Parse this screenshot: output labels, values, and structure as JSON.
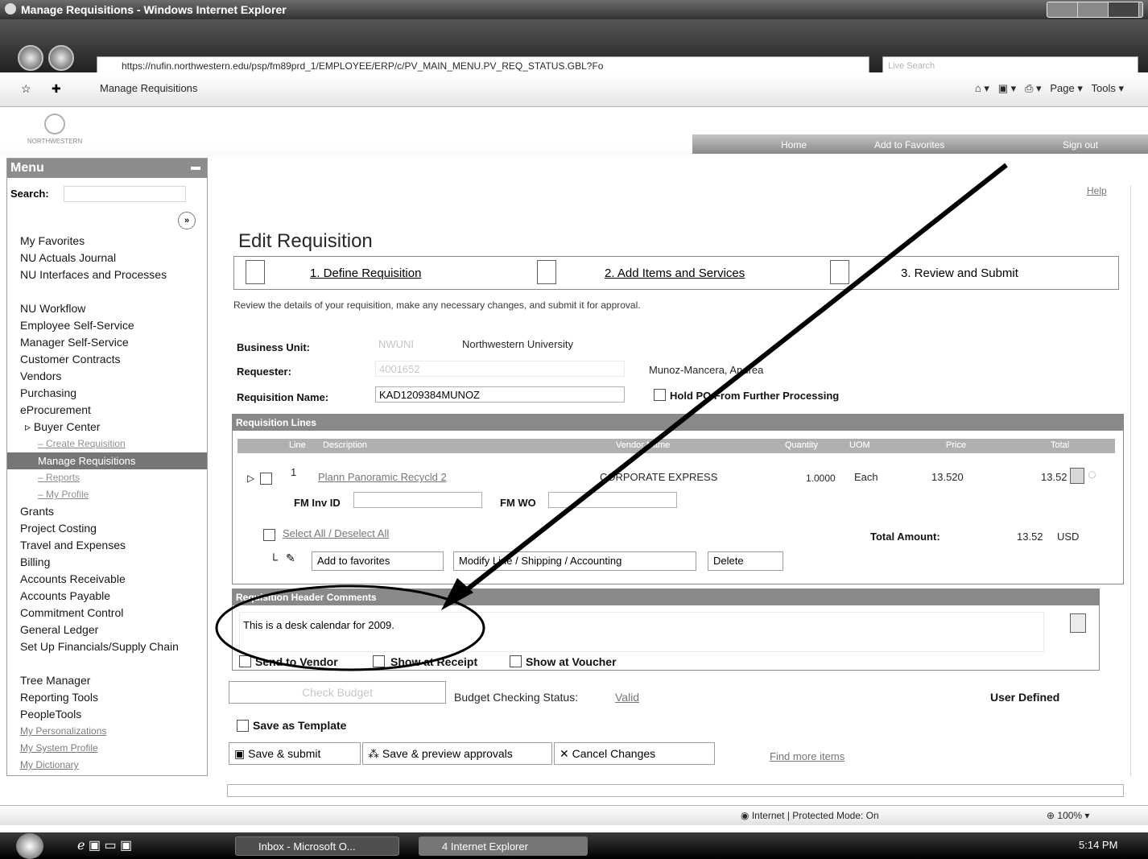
{
  "window": {
    "title": "Manage Requisitions - Windows Internet Explorer"
  },
  "browser": {
    "address": "https://nufin.northwestern.edu/psp/fm89prd_1/EMPLOYEE/ERP/c/PV_MAIN_MENU.PV_REQ_STATUS.GBL?Fo",
    "search_placeholder": "Live Search",
    "tab_title": "Manage Requisitions",
    "tools": [
      "Page ▾",
      "Tools ▾"
    ]
  },
  "header": {
    "logo_text": "NORTHWESTERN",
    "nav": [
      "Home",
      "Add to Favorites",
      "Sign out"
    ]
  },
  "menu": {
    "title": "Menu",
    "search_label": "Search:",
    "items": [
      "My Favorites",
      "NU Actuals Journal",
      "NU Interfaces and Processes",
      "NU Workflow",
      "Employee Self-Service",
      "Manager Self-Service",
      "Customer Contracts",
      "Vendors",
      "Purchasing",
      "eProcurement",
      "Buyer Center",
      "Create Requisition",
      "Manage Requisitions",
      "Reports",
      "My Profile",
      "Grants",
      "Project Costing",
      "Travel and Expenses",
      "Billing",
      "Accounts Receivable",
      "Accounts Payable",
      "Commitment Control",
      "General Ledger",
      "Set Up Financials/Supply Chain",
      "Tree Manager",
      "Reporting Tools",
      "PeopleTools",
      "My Personalizations",
      "My System Profile",
      "My Dictionary"
    ]
  },
  "content": {
    "help": "Help",
    "title": "Edit Requisition",
    "steps": [
      "1. Define Requisition",
      "2. Add Items and Services",
      "3. Review and Submit"
    ],
    "instructions": "Review the details of your requisition, make any necessary changes, and submit it for approval.",
    "business_unit_label": "Business Unit:",
    "business_unit_code": "NWUNI",
    "business_unit_name": "Northwestern University",
    "requester_label": "Requester:",
    "requester_id": "4001652",
    "requester_name": "Munoz-Mancera, Andrea",
    "req_name_label": "Requisition Name:",
    "req_name_value": "KAD1209384MUNOZ",
    "hold_label": "Hold PO From Further Processing",
    "lines_header": "Requisition Lines",
    "col_headers": [
      "Line",
      "Description",
      "Vendor Name",
      "Quantity",
      "UOM",
      "Price",
      "Total"
    ],
    "line": {
      "num": "1",
      "description": "Plann Panoramic Recycld 2",
      "vendor": "CORPORATE EXPRESS",
      "quantity": "1.0000",
      "uom": "Each",
      "price": "13.520",
      "total": "13.52"
    },
    "fm_inv_label": "FM Inv ID",
    "fm_wo_label": "FM WO",
    "select_all": "Select All / Deselect All",
    "total_amount_label": "Total Amount:",
    "total_amount_value": "13.52",
    "currency": "USD",
    "add_favorites": "Add to favorites",
    "modify_line": "Modify Line / Shipping / Accounting",
    "delete": "Delete",
    "comments_header": "Requisition Header Comments",
    "comment_text": "This is a desk calendar for 2009.",
    "send_to_vendor": "Send to Vendor",
    "show_at_receipt": "Show at Receipt",
    "show_at_voucher": "Show at Voucher",
    "check_budget": "Check Budget",
    "budget_status_label": "Budget Checking Status:",
    "budget_status_value": "Valid",
    "user_defined": "User Defined",
    "save_template": "Save as Template",
    "save_submit": "Save & submit",
    "save_preview": "Save & preview approvals",
    "cancel_changes": "Cancel Changes",
    "find_more": "Find more items"
  },
  "statusbar": {
    "zone": "Internet | Protected Mode: On",
    "zoom": "100%"
  },
  "taskbar": {
    "tasks": [
      "Inbox - Microsoft O...",
      "4 Internet Explorer"
    ],
    "clock": "5:14 PM"
  }
}
